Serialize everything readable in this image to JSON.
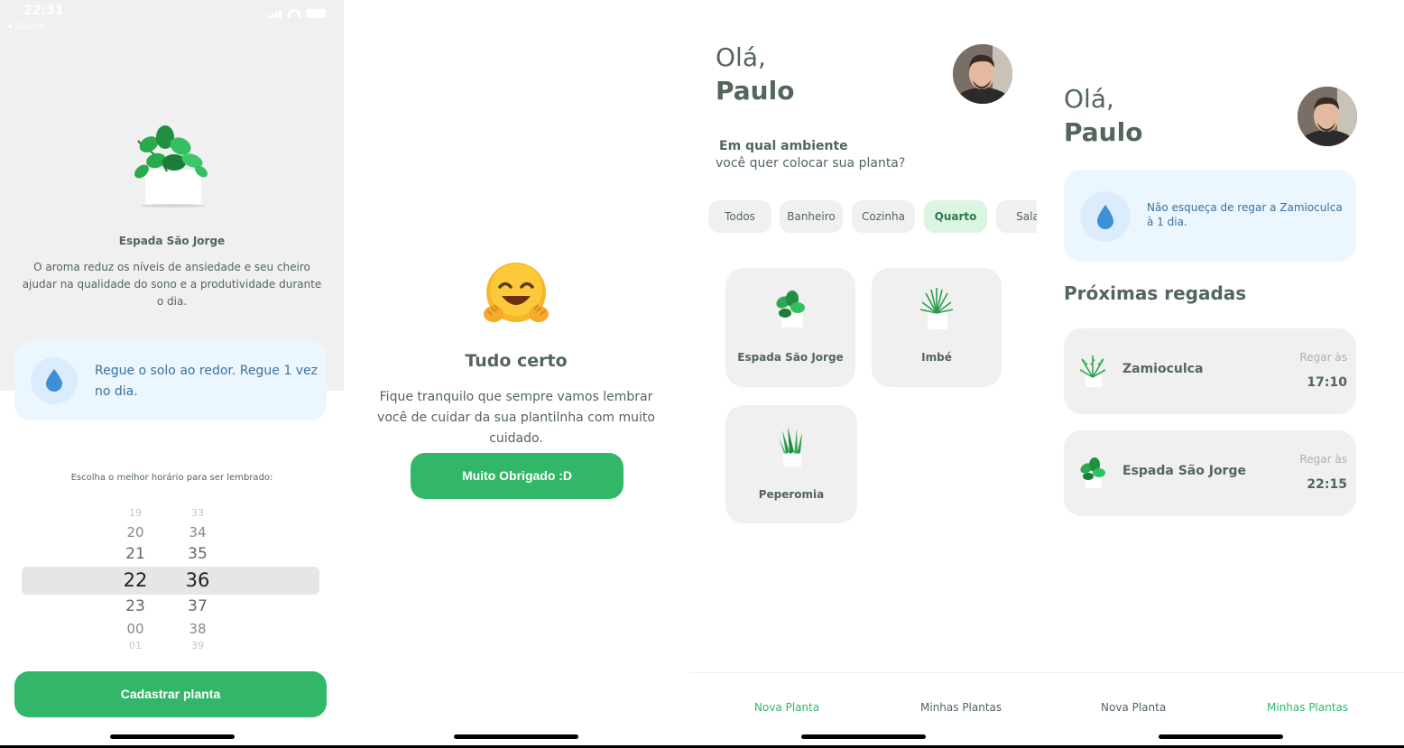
{
  "status_bar": {
    "time": "22:31",
    "back_label": "◂ Search"
  },
  "screen1": {
    "plant_name": "Espada São Jorge",
    "plant_description": "O aroma reduz os níveis de ansiedade e seu cheiro ajudar na qualidade do sono e a produtividade durante o dia.",
    "tip": "Regue o solo ao redor. Regue 1 vez no dia.",
    "picker_label": "Escolha o melhor horário para ser lembrado:",
    "hours": [
      "19",
      "20",
      "21",
      "22",
      "23",
      "00",
      "01"
    ],
    "minutes": [
      "33",
      "34",
      "35",
      "36",
      "37",
      "38",
      "39"
    ],
    "selected_hour": "22",
    "selected_minute": "36",
    "button": "Cadastrar planta"
  },
  "screen2": {
    "title": "Tudo certo",
    "subtitle": "Fique tranquilo que sempre vamos lembrar você de cuidar da sua plantilnha com muito cuidado.",
    "button": "Muito Obrigado :D"
  },
  "screen3": {
    "greeting": "Olá,",
    "user_name": "Paulo",
    "env_title": "Em qual ambiente",
    "env_subtitle": "você quer colocar sua planta?",
    "environments": [
      {
        "label": "Todos",
        "active": false
      },
      {
        "label": "Banheiro",
        "active": false
      },
      {
        "label": "Cozinha",
        "active": false
      },
      {
        "label": "Quarto",
        "active": true
      },
      {
        "label": "Sala",
        "active": false
      }
    ],
    "plants": [
      {
        "name": "Espada São Jorge",
        "icon": "pothos-plant-icon"
      },
      {
        "name": "Imbé",
        "icon": "spider-plant-icon"
      },
      {
        "name": "Peperomia",
        "icon": "snake-plant-icon"
      }
    ],
    "tabs": [
      {
        "label": "Nova Planta",
        "active": true
      },
      {
        "label": "Minhas Plantas",
        "active": false
      }
    ]
  },
  "screen4": {
    "greeting": "Olá,",
    "user_name": "Paulo",
    "tip": "Não esqueça de regar a Zamioculca à 1 dia.",
    "section_title": "Próximas regadas",
    "waterings": [
      {
        "name": "Zamioculca",
        "label": "Regar às",
        "time": "17:10"
      },
      {
        "name": "Espada São Jorge",
        "label": "Regar às",
        "time": "22:15"
      }
    ],
    "tabs": [
      {
        "label": "Nova Planta",
        "active": false
      },
      {
        "label": "Minhas Plantas",
        "active": true
      }
    ]
  },
  "colors": {
    "green": "#32b768",
    "heading": "#52665a",
    "blue_bg": "#ebf6ff",
    "blue_text": "#3d7199",
    "card_bg": "#f0f0f0"
  }
}
